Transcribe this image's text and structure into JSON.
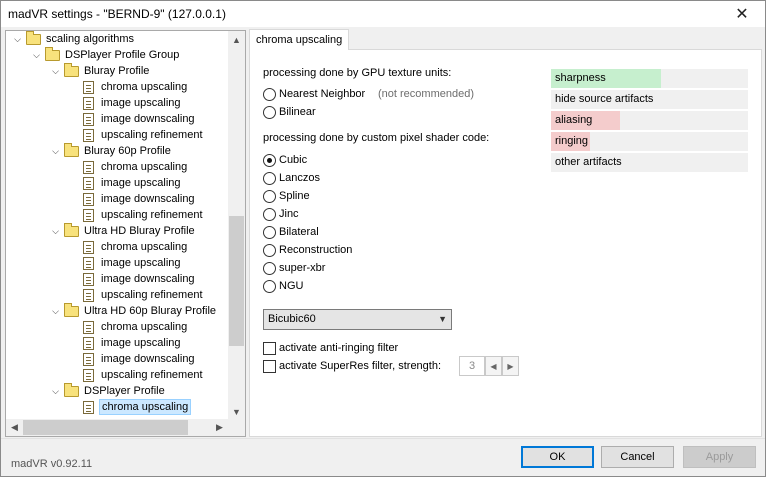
{
  "window": {
    "title": "madVR settings - \"BERND-9\" (127.0.0.1)"
  },
  "tree": {
    "items": [
      {
        "label": "scaling algorithms",
        "type": "folder",
        "level": 0,
        "expanded": true
      },
      {
        "label": "DSPlayer Profile Group",
        "type": "folder",
        "level": 1,
        "expanded": true
      },
      {
        "label": "Bluray Profile",
        "type": "folder",
        "level": 2,
        "expanded": true
      },
      {
        "label": "chroma upscaling",
        "type": "doc",
        "level": 3
      },
      {
        "label": "image upscaling",
        "type": "doc",
        "level": 3
      },
      {
        "label": "image downscaling",
        "type": "doc",
        "level": 3
      },
      {
        "label": "upscaling refinement",
        "type": "doc",
        "level": 3
      },
      {
        "label": "Bluray 60p Profile",
        "type": "folder",
        "level": 2,
        "expanded": true
      },
      {
        "label": "chroma upscaling",
        "type": "doc",
        "level": 3
      },
      {
        "label": "image upscaling",
        "type": "doc",
        "level": 3
      },
      {
        "label": "image downscaling",
        "type": "doc",
        "level": 3
      },
      {
        "label": "upscaling refinement",
        "type": "doc",
        "level": 3
      },
      {
        "label": "Ultra HD Bluray Profile",
        "type": "folder",
        "level": 2,
        "expanded": true
      },
      {
        "label": "chroma upscaling",
        "type": "doc",
        "level": 3
      },
      {
        "label": "image upscaling",
        "type": "doc",
        "level": 3
      },
      {
        "label": "image downscaling",
        "type": "doc",
        "level": 3
      },
      {
        "label": "upscaling refinement",
        "type": "doc",
        "level": 3
      },
      {
        "label": "Ultra HD 60p Bluray Profile",
        "type": "folder",
        "level": 2,
        "expanded": true
      },
      {
        "label": "chroma upscaling",
        "type": "doc",
        "level": 3
      },
      {
        "label": "image upscaling",
        "type": "doc",
        "level": 3
      },
      {
        "label": "image downscaling",
        "type": "doc",
        "level": 3
      },
      {
        "label": "upscaling refinement",
        "type": "doc",
        "level": 3
      },
      {
        "label": "DSPlayer Profile",
        "type": "folder",
        "level": 2,
        "expanded": true
      },
      {
        "label": "chroma upscaling",
        "type": "doc",
        "level": 3,
        "selected": true
      }
    ]
  },
  "tab": {
    "label": "chroma upscaling"
  },
  "gpu_section": {
    "label": "processing done by GPU texture units:",
    "options": [
      {
        "label": "Nearest Neighbor",
        "checked": false
      },
      {
        "label": "Bilinear",
        "checked": false
      }
    ],
    "note": "(not recommended)"
  },
  "shader_section": {
    "label": "processing done by custom pixel shader code:",
    "options": [
      {
        "label": "Cubic",
        "checked": true
      },
      {
        "label": "Lanczos",
        "checked": false
      },
      {
        "label": "Spline",
        "checked": false
      },
      {
        "label": "Jinc",
        "checked": false
      },
      {
        "label": "Bilateral",
        "checked": false
      },
      {
        "label": "Reconstruction",
        "checked": false
      },
      {
        "label": "super-xbr",
        "checked": false
      },
      {
        "label": "NGU",
        "checked": false
      }
    ]
  },
  "quality": [
    {
      "label": "sharpness",
      "level": 0.56,
      "color": "#c6efce"
    },
    {
      "label": "hide source artifacts",
      "level": 0,
      "color": "#f0f0f0"
    },
    {
      "label": "aliasing",
      "level": 0.35,
      "color": "#f4cccc"
    },
    {
      "label": "ringing",
      "level": 0.2,
      "color": "#f4cccc"
    },
    {
      "label": "other artifacts",
      "level": 0,
      "color": "#f0f0f0"
    }
  ],
  "filter_select": {
    "value": "Bicubic60"
  },
  "anti_ringing": {
    "label": "activate anti-ringing filter",
    "checked": false
  },
  "superres": {
    "label": "activate SuperRes filter, strength:",
    "checked": false,
    "strength": "3"
  },
  "footer": {
    "version": "madVR v0.92.11",
    "ok_label": "OK",
    "cancel_label": "Cancel",
    "apply_label": "Apply"
  }
}
